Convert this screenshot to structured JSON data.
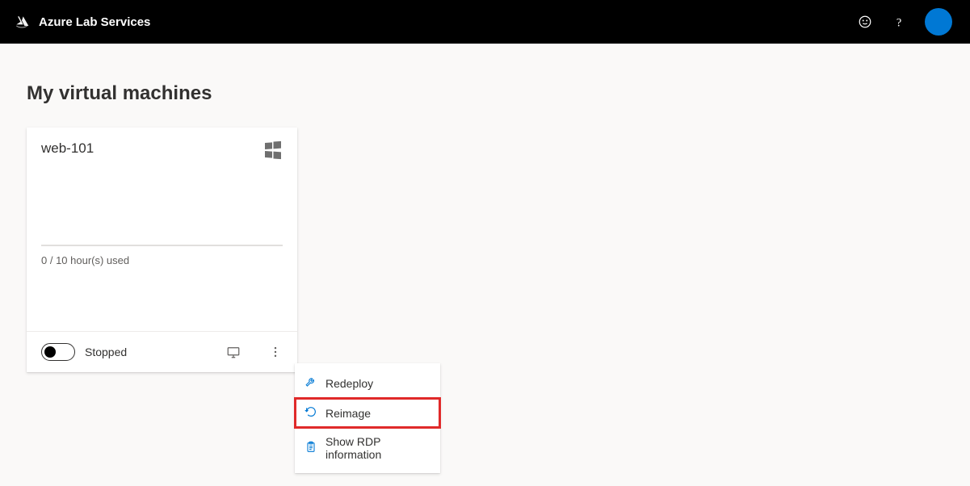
{
  "header": {
    "app_name": "Azure Lab Services"
  },
  "page": {
    "title": "My virtual machines"
  },
  "vm": {
    "name": "web-101",
    "hours_used": "0 / 10 hour(s) used",
    "status_label": "Stopped"
  },
  "menu": {
    "redeploy": "Redeploy",
    "reimage": "Reimage",
    "rdp": "Show RDP information"
  }
}
